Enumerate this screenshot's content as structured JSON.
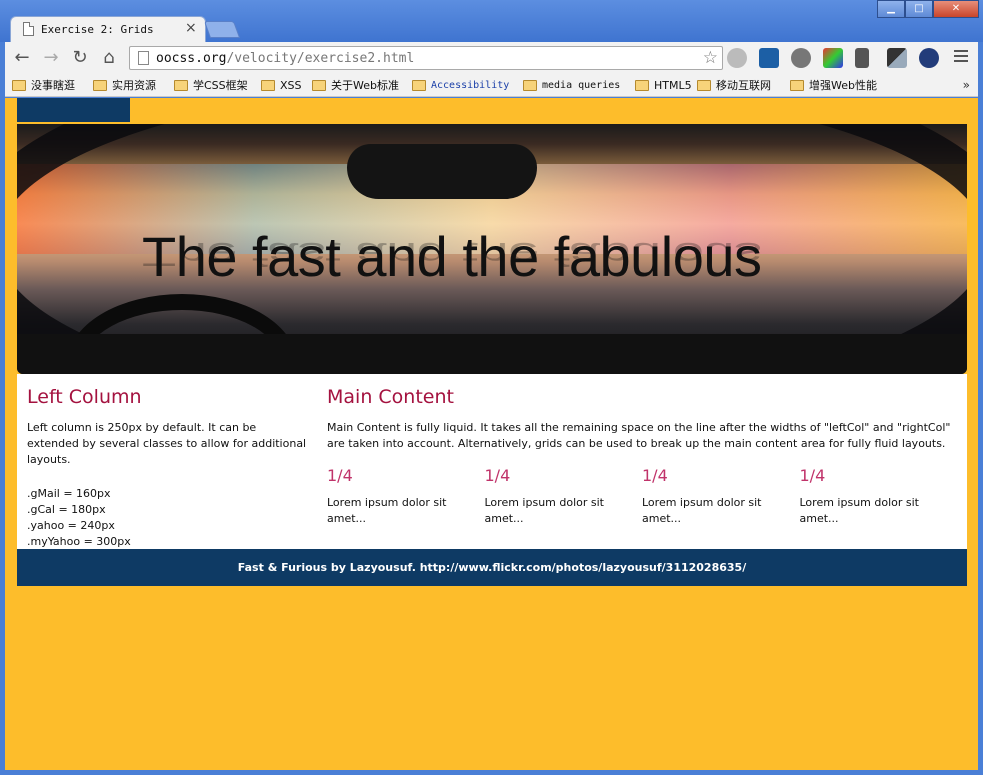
{
  "browser": {
    "tab_title": "Exercise 2: Grids",
    "tab_close": "×",
    "window_controls": {
      "minimize": "▁",
      "maximize": "□",
      "close": "✕"
    },
    "nav": {
      "back": "←",
      "forward": "→",
      "reload": "↻",
      "home": "⌂"
    },
    "url_host": "oocss.org",
    "url_path": "/velocity/exercise2.html",
    "bookmark_star": "☆"
  },
  "bookmarks": [
    "没事瞎逛",
    "实用资源",
    "学CSS框架",
    "XSS",
    "关于Web标准",
    "Accessibility",
    "media queries",
    "HTML5",
    "移动互联网",
    "增强Web性能"
  ],
  "bookmarks_more": "»",
  "hero": {
    "headline": "The fast and the fabulous"
  },
  "left_column": {
    "title": "Left Column",
    "text": "Left column is 250px by default. It can be extended by several classes to allow for additional layouts.",
    "classes": [
      ".gMail = 160px",
      ".gCal = 180px",
      ".yahoo = 240px",
      ".myYahoo = 300px"
    ]
  },
  "main_content": {
    "title": "Main Content",
    "text": "Main Content is fully liquid. It takes all the remaining space on the line after the widths of \"leftCol\" and \"rightCol\" are taken into account. Alternatively, grids can be used to break up the main content area for fully fluid layouts.",
    "units": [
      {
        "heading": "1/4",
        "text": "Lorem ipsum dolor sit amet..."
      },
      {
        "heading": "1/4",
        "text": "Lorem ipsum dolor sit amet..."
      },
      {
        "heading": "1/4",
        "text": "Lorem ipsum dolor sit amet..."
      },
      {
        "heading": "1/4",
        "text": "Lorem ipsum dolor sit amet..."
      }
    ]
  },
  "footer": {
    "credit": "Fast & Furious by Lazyousuf. http://www.flickr.com/photos/lazyousuf/3112028635/"
  },
  "colors": {
    "page_bg": "#fdbd2b",
    "navy": "#0e3a64",
    "heading": "#a4123f",
    "unit_heading": "#c0336a"
  }
}
